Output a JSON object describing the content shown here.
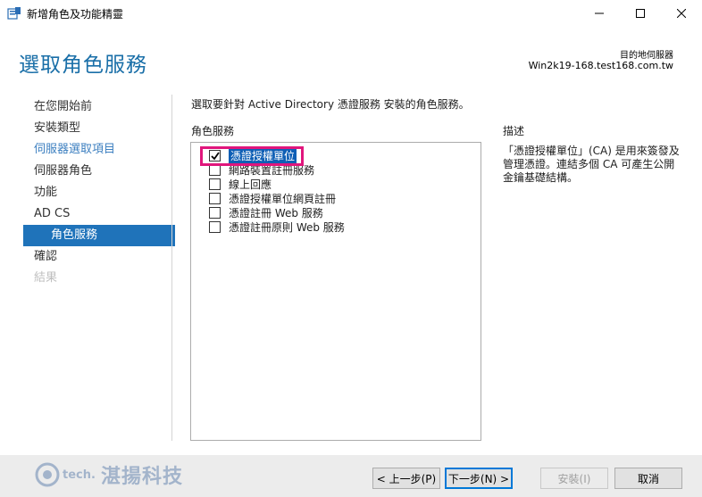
{
  "window": {
    "title": "新增角色及功能精靈",
    "icons": {
      "app": "server-manager-icon",
      "minimize": "minimize-icon",
      "maximize": "maximize-icon",
      "close": "close-icon"
    }
  },
  "header": {
    "page_title": "選取角色服務",
    "destination_label": "目的地伺服器",
    "destination_server": "Win2k19-168.test168.com.tw"
  },
  "nav": {
    "items": [
      {
        "label": "在您開始前",
        "state": "normal"
      },
      {
        "label": "安裝類型",
        "state": "normal"
      },
      {
        "label": "伺服器選取項目",
        "state": "normal"
      },
      {
        "label": "伺服器角色",
        "state": "normal"
      },
      {
        "label": "功能",
        "state": "normal"
      },
      {
        "label": "AD CS",
        "state": "normal"
      },
      {
        "label": "角色服務",
        "state": "active"
      },
      {
        "label": "確認",
        "state": "normal"
      },
      {
        "label": "結果",
        "state": "disabled"
      }
    ]
  },
  "main": {
    "instruction": "選取要針對 Active Directory 憑證服務 安裝的角色服務。",
    "roles_label": "角色服務",
    "roles": [
      {
        "label": "憑證授權單位",
        "checked": true
      },
      {
        "label": "網路裝置註冊服務",
        "checked": false
      },
      {
        "label": "線上回應",
        "checked": false
      },
      {
        "label": "憑證授權單位網頁註冊",
        "checked": false
      },
      {
        "label": "憑證註冊 Web 服務",
        "checked": false
      },
      {
        "label": "憑證註冊原則 Web 服務",
        "checked": false
      }
    ],
    "description_label": "描述",
    "description_text": "「憑證授權單位」(CA) 是用來簽發及管理憑證。連結多個 CA 可產生公開金鑰基礎結構。"
  },
  "footer": {
    "watermark": "湛揚科技",
    "watermark_sub": "tech.",
    "buttons": {
      "previous": "< 上一步(P)",
      "next": "下一步(N) >",
      "install": "安裝(I)",
      "cancel": "取消"
    }
  },
  "colors": {
    "title_blue": "#1a6fa8",
    "nav_active": "#1f73ba",
    "selection": "#0f5fb5",
    "highlight_frame": "#e0167c"
  }
}
